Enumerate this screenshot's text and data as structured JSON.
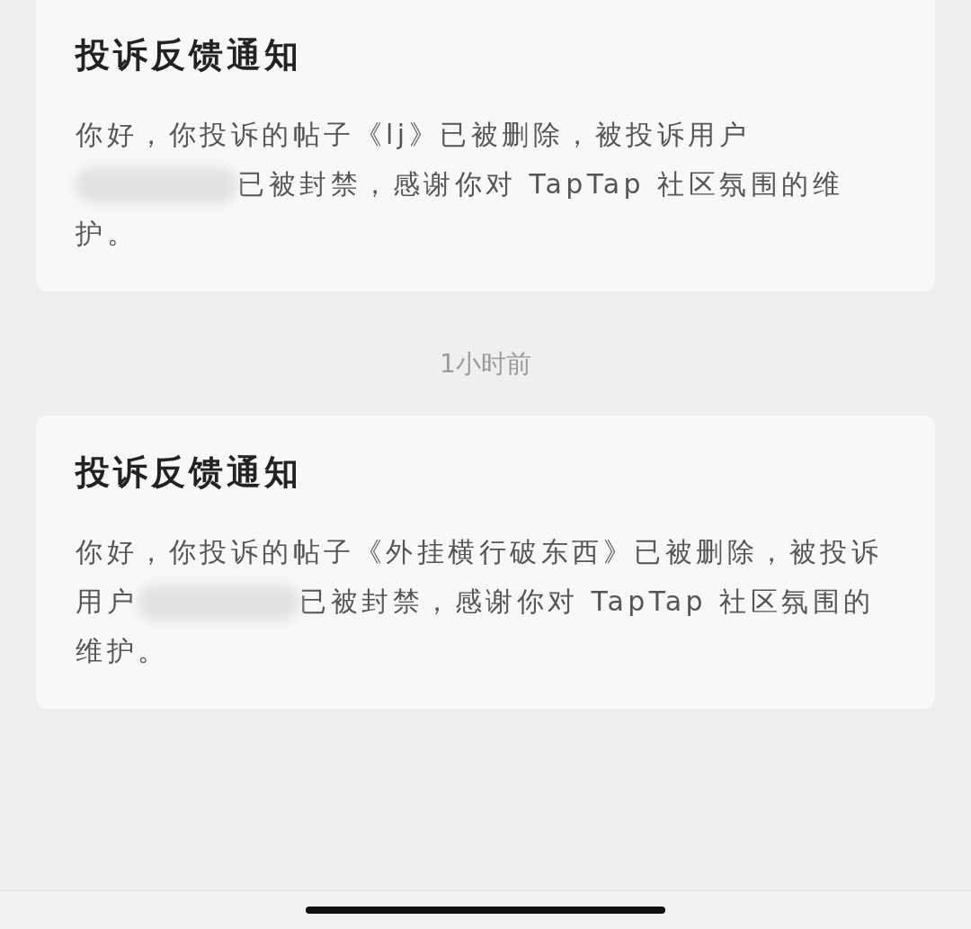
{
  "notifications": [
    {
      "title": "投诉反馈通知",
      "lines": [
        {
          "kind": "text",
          "text": "你好，你投诉的帖子《lj》已被删除，被投诉用户"
        },
        {
          "kind": "redacted",
          "text": "已被封禁，感谢你对 TapTap 社区氛围的维"
        },
        {
          "kind": "text",
          "text": "护。"
        }
      ],
      "timestamp": "1小时前"
    },
    {
      "title": "投诉反馈通知",
      "lines": [
        {
          "kind": "text",
          "text": "你好，你投诉的帖子《外挂横行破东西》已被删除，被投诉"
        },
        {
          "kind": "redacted",
          "before": "用户",
          "text": "已被封禁，感谢你对 TapTap 社区氛围的"
        },
        {
          "kind": "text",
          "text": "维护。"
        }
      ]
    }
  ]
}
